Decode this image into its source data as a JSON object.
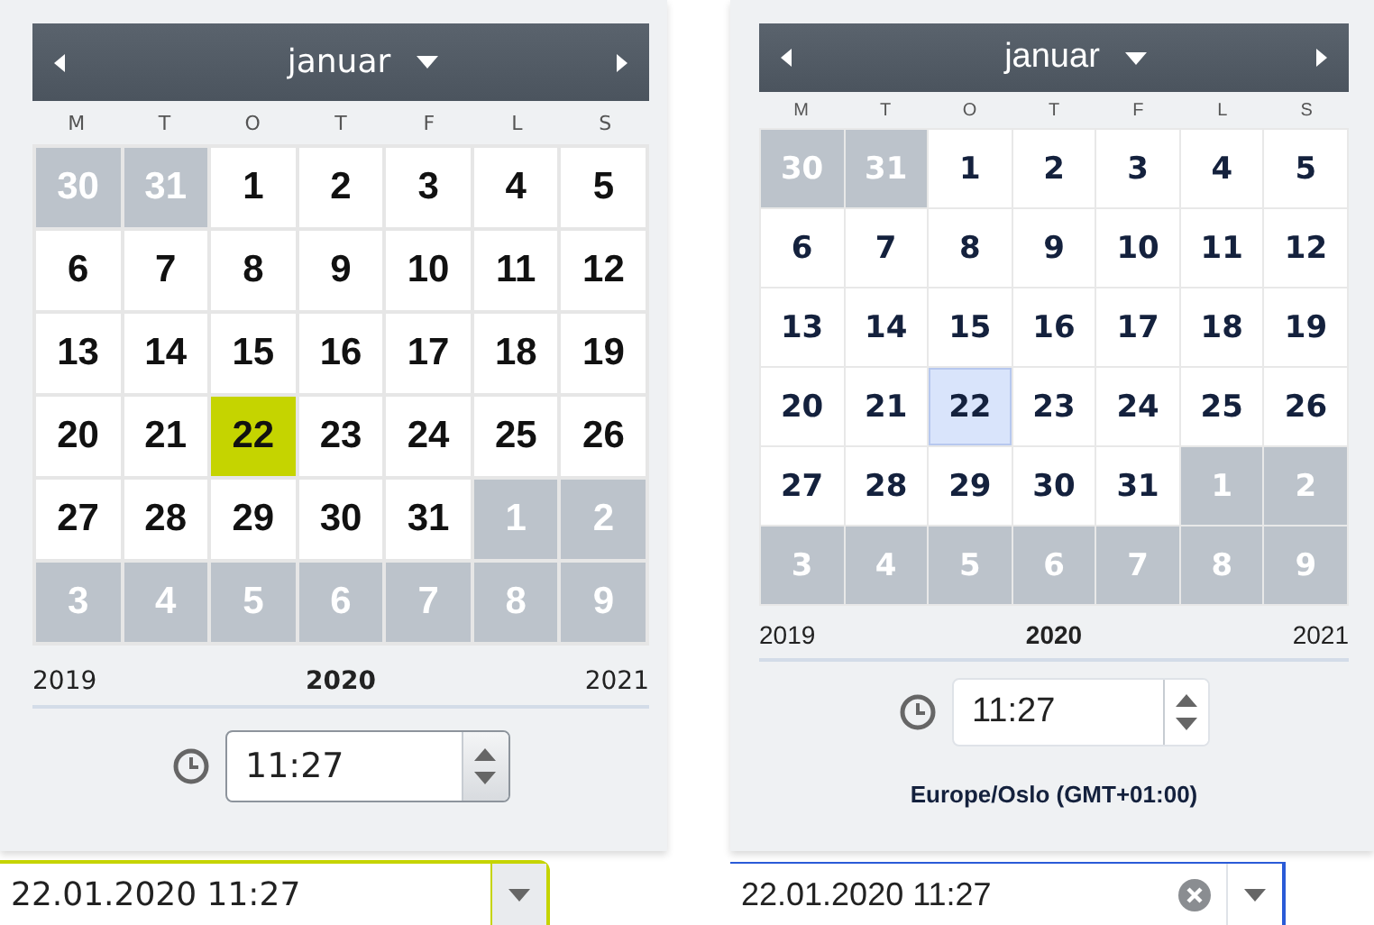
{
  "pickers": [
    {
      "kind": "classic",
      "month": "januar",
      "weekdays": [
        "M",
        "T",
        "O",
        "T",
        "F",
        "L",
        "S"
      ],
      "weeks": [
        [
          {
            "day": "30",
            "other_month": true,
            "selected": false
          },
          {
            "day": "31",
            "other_month": true,
            "selected": false
          },
          {
            "day": "1",
            "other_month": false,
            "selected": false
          },
          {
            "day": "2",
            "other_month": false,
            "selected": false
          },
          {
            "day": "3",
            "other_month": false,
            "selected": false
          },
          {
            "day": "4",
            "other_month": false,
            "selected": false
          },
          {
            "day": "5",
            "other_month": false,
            "selected": false
          }
        ],
        [
          {
            "day": "6",
            "other_month": false,
            "selected": false
          },
          {
            "day": "7",
            "other_month": false,
            "selected": false
          },
          {
            "day": "8",
            "other_month": false,
            "selected": false
          },
          {
            "day": "9",
            "other_month": false,
            "selected": false
          },
          {
            "day": "10",
            "other_month": false,
            "selected": false
          },
          {
            "day": "11",
            "other_month": false,
            "selected": false
          },
          {
            "day": "12",
            "other_month": false,
            "selected": false
          }
        ],
        [
          {
            "day": "13",
            "other_month": false,
            "selected": false
          },
          {
            "day": "14",
            "other_month": false,
            "selected": false
          },
          {
            "day": "15",
            "other_month": false,
            "selected": false
          },
          {
            "day": "16",
            "other_month": false,
            "selected": false
          },
          {
            "day": "17",
            "other_month": false,
            "selected": false
          },
          {
            "day": "18",
            "other_month": false,
            "selected": false
          },
          {
            "day": "19",
            "other_month": false,
            "selected": false
          }
        ],
        [
          {
            "day": "20",
            "other_month": false,
            "selected": false
          },
          {
            "day": "21",
            "other_month": false,
            "selected": false
          },
          {
            "day": "22",
            "other_month": false,
            "selected": true
          },
          {
            "day": "23",
            "other_month": false,
            "selected": false
          },
          {
            "day": "24",
            "other_month": false,
            "selected": false
          },
          {
            "day": "25",
            "other_month": false,
            "selected": false
          },
          {
            "day": "26",
            "other_month": false,
            "selected": false
          }
        ],
        [
          {
            "day": "27",
            "other_month": false,
            "selected": false
          },
          {
            "day": "28",
            "other_month": false,
            "selected": false
          },
          {
            "day": "29",
            "other_month": false,
            "selected": false
          },
          {
            "day": "30",
            "other_month": false,
            "selected": false
          },
          {
            "day": "31",
            "other_month": false,
            "selected": false
          },
          {
            "day": "1",
            "other_month": true,
            "selected": false
          },
          {
            "day": "2",
            "other_month": true,
            "selected": false
          }
        ],
        [
          {
            "day": "3",
            "other_month": true,
            "selected": false
          },
          {
            "day": "4",
            "other_month": true,
            "selected": false
          },
          {
            "day": "5",
            "other_month": true,
            "selected": false
          },
          {
            "day": "6",
            "other_month": true,
            "selected": false
          },
          {
            "day": "7",
            "other_month": true,
            "selected": false
          },
          {
            "day": "8",
            "other_month": true,
            "selected": false
          },
          {
            "day": "9",
            "other_month": true,
            "selected": false
          }
        ]
      ],
      "years": {
        "previous": "2019",
        "current": "2020",
        "next": "2021"
      },
      "time": "11:27",
      "value": "22.01.2020 11:27",
      "clearable": false
    },
    {
      "kind": "modern",
      "month": "januar",
      "weekdays": [
        "M",
        "T",
        "O",
        "T",
        "F",
        "L",
        "S"
      ],
      "weeks": [
        [
          {
            "day": "30",
            "other_month": true,
            "selected": false
          },
          {
            "day": "31",
            "other_month": true,
            "selected": false
          },
          {
            "day": "1",
            "other_month": false,
            "selected": false
          },
          {
            "day": "2",
            "other_month": false,
            "selected": false
          },
          {
            "day": "3",
            "other_month": false,
            "selected": false
          },
          {
            "day": "4",
            "other_month": false,
            "selected": false
          },
          {
            "day": "5",
            "other_month": false,
            "selected": false
          }
        ],
        [
          {
            "day": "6",
            "other_month": false,
            "selected": false
          },
          {
            "day": "7",
            "other_month": false,
            "selected": false
          },
          {
            "day": "8",
            "other_month": false,
            "selected": false
          },
          {
            "day": "9",
            "other_month": false,
            "selected": false
          },
          {
            "day": "10",
            "other_month": false,
            "selected": false
          },
          {
            "day": "11",
            "other_month": false,
            "selected": false
          },
          {
            "day": "12",
            "other_month": false,
            "selected": false
          }
        ],
        [
          {
            "day": "13",
            "other_month": false,
            "selected": false
          },
          {
            "day": "14",
            "other_month": false,
            "selected": false
          },
          {
            "day": "15",
            "other_month": false,
            "selected": false
          },
          {
            "day": "16",
            "other_month": false,
            "selected": false
          },
          {
            "day": "17",
            "other_month": false,
            "selected": false
          },
          {
            "day": "18",
            "other_month": false,
            "selected": false
          },
          {
            "day": "19",
            "other_month": false,
            "selected": false
          }
        ],
        [
          {
            "day": "20",
            "other_month": false,
            "selected": false
          },
          {
            "day": "21",
            "other_month": false,
            "selected": false
          },
          {
            "day": "22",
            "other_month": false,
            "selected": true
          },
          {
            "day": "23",
            "other_month": false,
            "selected": false
          },
          {
            "day": "24",
            "other_month": false,
            "selected": false
          },
          {
            "day": "25",
            "other_month": false,
            "selected": false
          },
          {
            "day": "26",
            "other_month": false,
            "selected": false
          }
        ],
        [
          {
            "day": "27",
            "other_month": false,
            "selected": false
          },
          {
            "day": "28",
            "other_month": false,
            "selected": false
          },
          {
            "day": "29",
            "other_month": false,
            "selected": false
          },
          {
            "day": "30",
            "other_month": false,
            "selected": false
          },
          {
            "day": "31",
            "other_month": false,
            "selected": false
          },
          {
            "day": "1",
            "other_month": true,
            "selected": false
          },
          {
            "day": "2",
            "other_month": true,
            "selected": false
          }
        ],
        [
          {
            "day": "3",
            "other_month": true,
            "selected": false
          },
          {
            "day": "4",
            "other_month": true,
            "selected": false
          },
          {
            "day": "5",
            "other_month": true,
            "selected": false
          },
          {
            "day": "6",
            "other_month": true,
            "selected": false
          },
          {
            "day": "7",
            "other_month": true,
            "selected": false
          },
          {
            "day": "8",
            "other_month": true,
            "selected": false
          },
          {
            "day": "9",
            "other_month": true,
            "selected": false
          }
        ]
      ],
      "years": {
        "previous": "2019",
        "current": "2020",
        "next": "2021"
      },
      "time": "11:27",
      "timezone": "Europe/Oslo (GMT+01:00)",
      "value": "22.01.2020 11:27",
      "clearable": true
    }
  ]
}
